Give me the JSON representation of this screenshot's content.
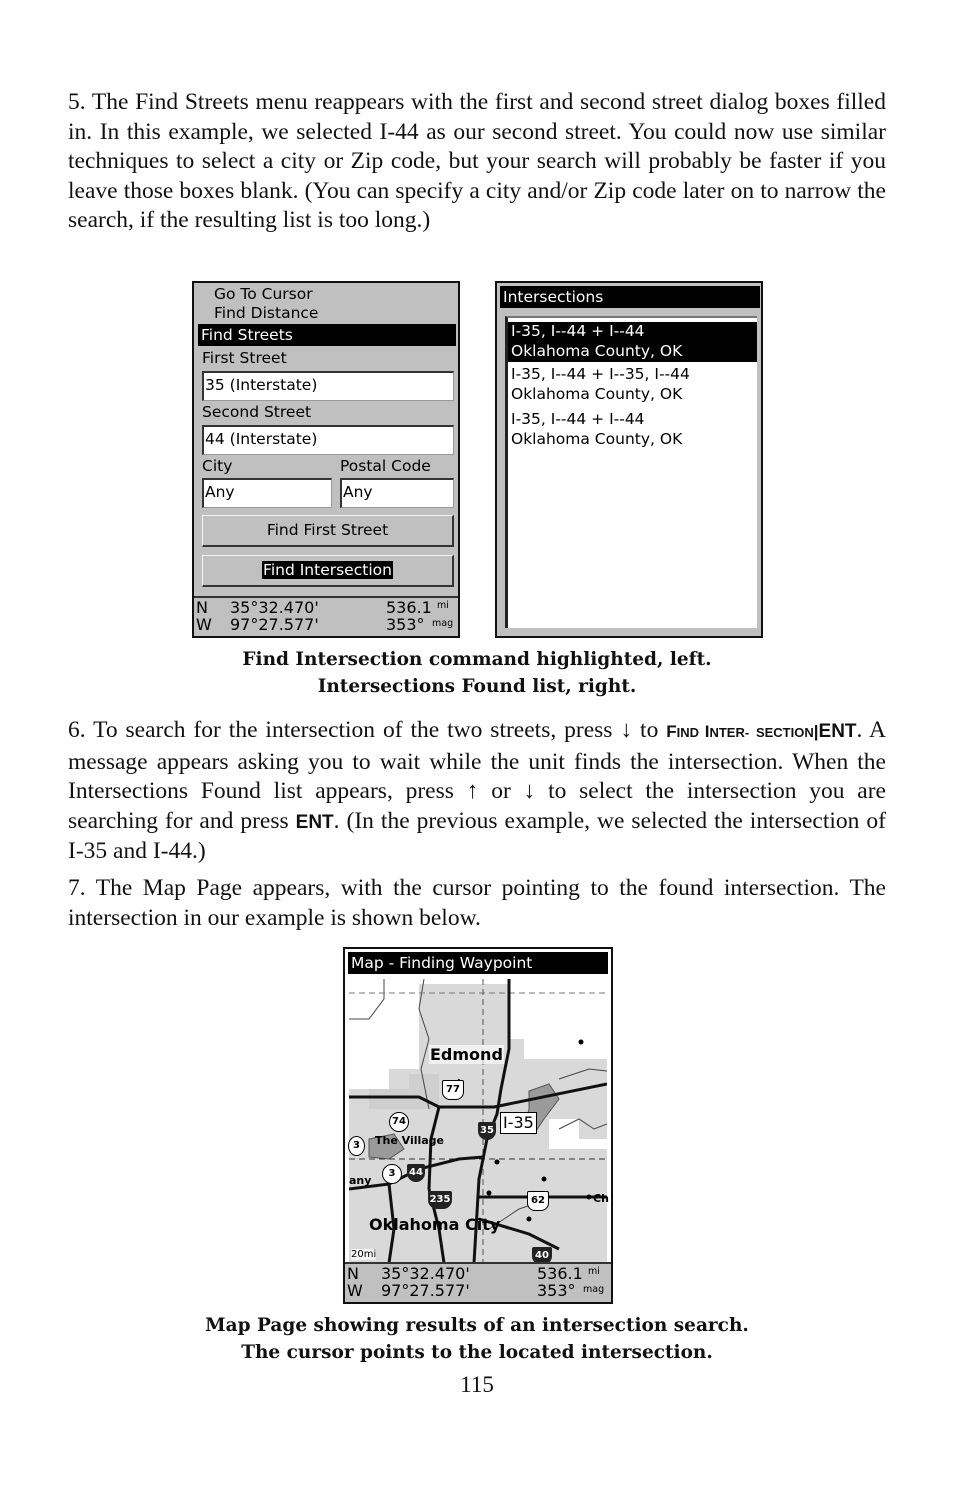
{
  "page": {
    "paragraph_5": "5. The Find Streets menu reappears with the first and second street dialog boxes filled in. In this example, we selected I-44 as our second street. You could now use similar techniques to select a city or Zip code, but your search will probably be faster if you leave those boxes blank. (You can specify a city and/or Zip code later on to narrow the search, if the resulting list is too long.)",
    "caption_1": {
      "line1": "Find Intersection command highlighted, left.",
      "line2": "Intersections Found list, right."
    },
    "paragraph_6": {
      "part1": "6. To search for the intersection of the two streets, press ",
      "arrow_down": "↓",
      "part2": " to ",
      "cmd_find_f": "F",
      "cmd_find_rest": "IND ",
      "cmd_inter_i": "I",
      "cmd_inter_rest": "NTER-",
      "cmd_section": "SECTION",
      "separator": "|",
      "key_ent": "ENT",
      "part3": ". A message appears asking you to wait while the unit finds the intersection. When the Intersections Found list appears, press ",
      "arrow_up": "↑",
      "part4": " or ",
      "arrow_down2": "↓",
      "part5": " to select the intersection you are searching for and press ",
      "key_ent2": "ENT",
      "part6": ". (In the previous example, we selected the intersection of I-35 and I-44.)"
    },
    "paragraph_7": "7. The Map Page appears, with the cursor pointing to the found intersection. The intersection in our example is shown below.",
    "caption_2": {
      "line1": "Map Page showing results of an intersection search.",
      "line2": "The cursor points to the located intersection."
    },
    "page_number": "115"
  },
  "find_streets_screen": {
    "menu_items": [
      "Go To Cursor",
      "Find Distance"
    ],
    "title": "Find Streets",
    "first_street_label": "First Street",
    "first_street_value": "35 (Interstate)",
    "second_street_label": "Second Street",
    "second_street_value": "44 (Interstate)",
    "city_label": "City",
    "city_value": "Any",
    "postal_label": "Postal Code",
    "postal_value": "Any",
    "find_first_street_button": "Find First Street",
    "find_intersection_button": "Find Intersection",
    "status": {
      "lat_hemi": "N",
      "lat": "35°32.470'",
      "lon_hemi": "W",
      "lon": "97°27.577'",
      "distance": "536.1",
      "distance_unit": "mi",
      "bearing": "353°",
      "bearing_unit": "mag"
    }
  },
  "intersections_screen": {
    "title": "Intersections",
    "items": [
      {
        "line1": "I-35, I--44 + I--44",
        "line2": "Oklahoma County, OK",
        "selected": true
      },
      {
        "line1": "I-35, I--44 + I--35, I--44",
        "line2": "Oklahoma County, OK",
        "selected": false
      },
      {
        "line1": "I-35, I--44 + I--44",
        "line2": "Oklahoma County, OK",
        "selected": false
      }
    ]
  },
  "map_screen": {
    "title": "Map - Finding Waypoint",
    "labels": {
      "edmond": "Edmond",
      "the_village": "The Village",
      "bethany_partial": "any",
      "oklahoma_city": "Oklahoma City",
      "ch_partial": "Ch",
      "i35_box": "I-35"
    },
    "shields": {
      "us77": "77",
      "us62": "62",
      "sh74": "74",
      "sh3a": "3",
      "sh3b": "3",
      "i35": "35",
      "i44": "44",
      "i235": "235",
      "i40": "40"
    },
    "scale": "20mi",
    "status": {
      "lat_hemi": "N",
      "lat": "35°32.470'",
      "lon_hemi": "W",
      "lon": "97°27.577'",
      "distance": "536.1",
      "distance_unit": "mi",
      "bearing": "353°",
      "bearing_unit": "mag"
    }
  }
}
